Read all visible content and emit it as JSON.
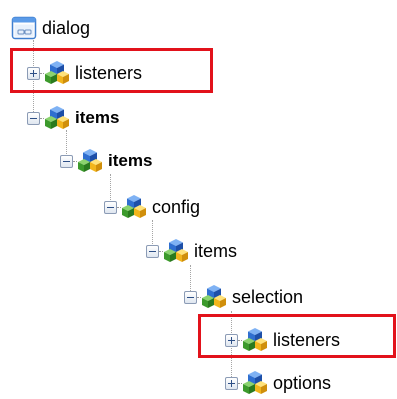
{
  "tree": {
    "root": {
      "label": "dialog",
      "icon": "dialog-window-icon"
    },
    "nodes": [
      {
        "label": "listeners",
        "icon": "node-cubes-icon",
        "toggle": "plus",
        "highlighted": true
      },
      {
        "label": "items",
        "icon": "node-cubes-icon",
        "toggle": "minus",
        "highlighted": false
      },
      {
        "label": "items",
        "icon": "node-cubes-icon",
        "toggle": "minus",
        "highlighted": false
      },
      {
        "label": "config",
        "icon": "node-cubes-icon",
        "toggle": "minus",
        "highlighted": false
      },
      {
        "label": "items",
        "icon": "node-cubes-icon",
        "toggle": "minus",
        "highlighted": false
      },
      {
        "label": "selection",
        "icon": "node-cubes-icon",
        "toggle": "minus",
        "highlighted": false
      },
      {
        "label": "listeners",
        "icon": "node-cubes-icon",
        "toggle": "plus",
        "highlighted": true
      },
      {
        "label": "options",
        "icon": "node-cubes-icon",
        "toggle": "plus",
        "highlighted": false
      }
    ]
  },
  "colors": {
    "highlight_border": "#e2121b",
    "cube_blue": "#2f6fd0",
    "cube_green": "#3c9a2c",
    "cube_yellow": "#f2b51c",
    "toggle_border": "#8b9bb5"
  }
}
